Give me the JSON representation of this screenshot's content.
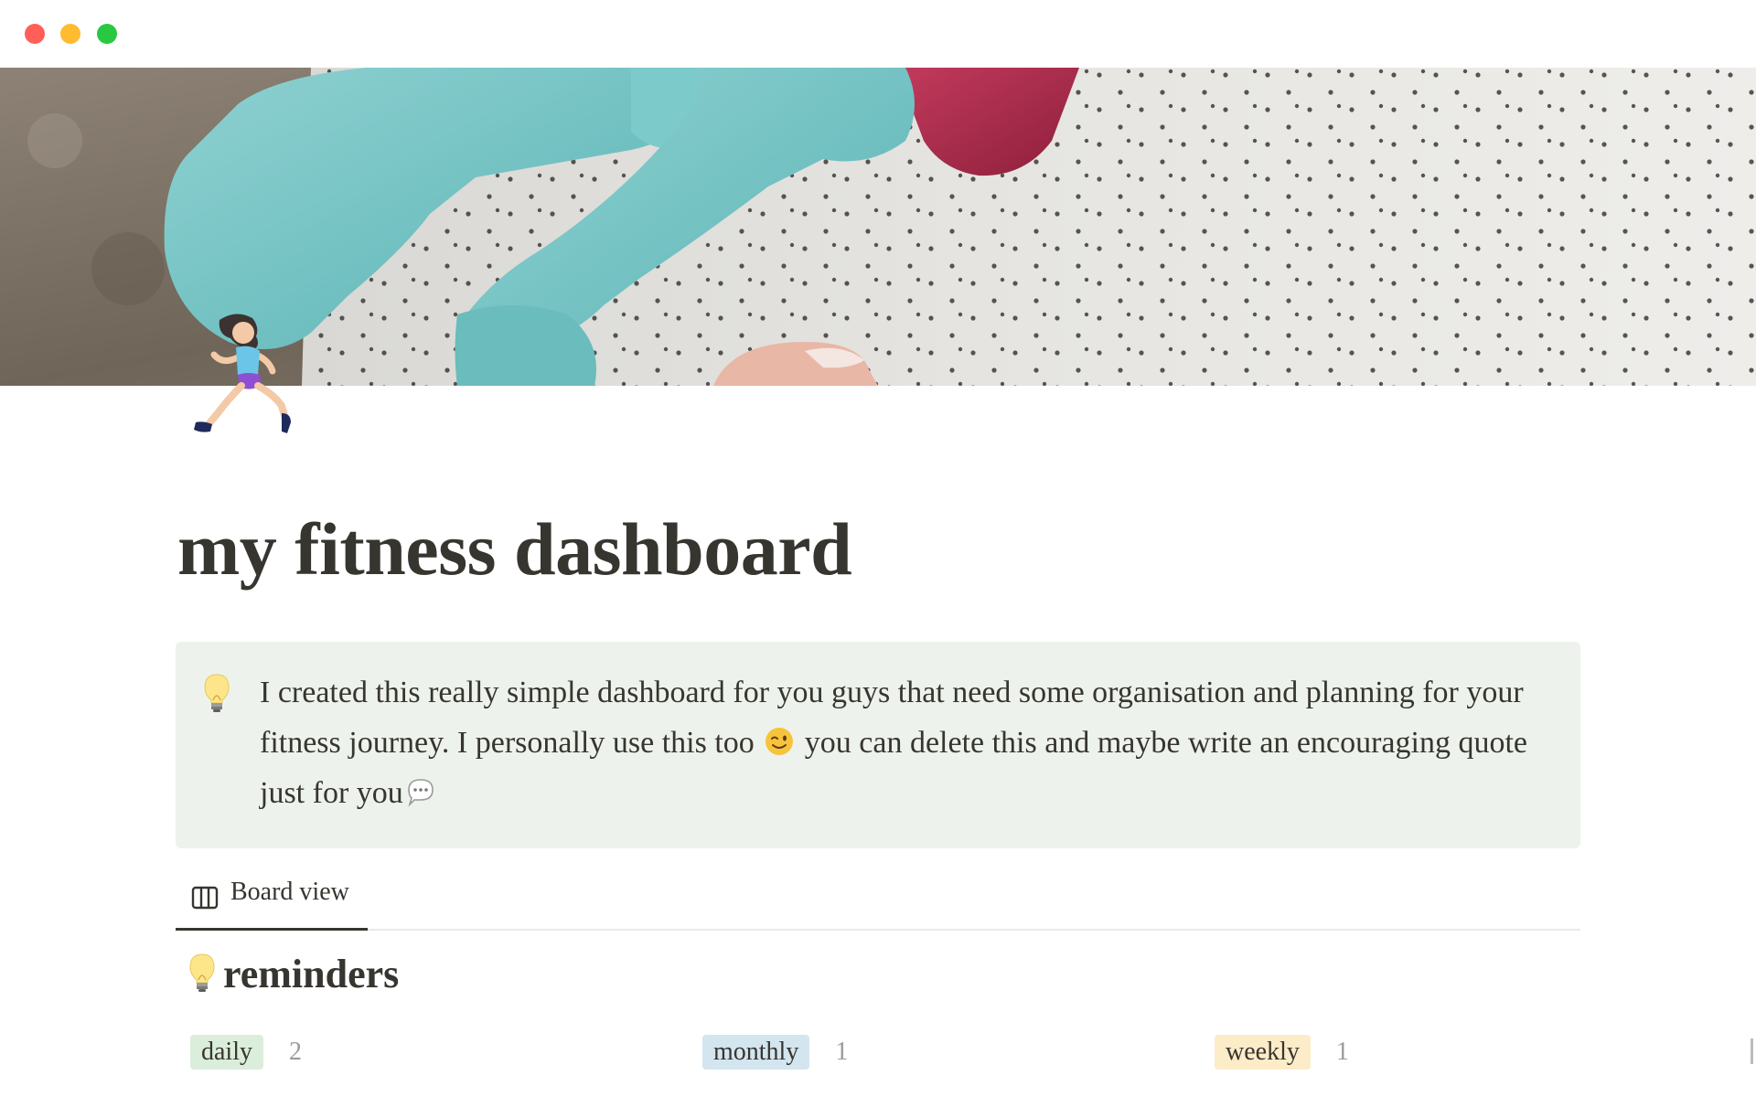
{
  "window": {
    "controls": [
      "close",
      "minimize",
      "maximize"
    ]
  },
  "cover": {
    "icon_name": "dumbbells-cover-image"
  },
  "page": {
    "icon_name": "woman-running-icon",
    "title": "my fitness dashboard"
  },
  "callout": {
    "icon_name": "light-bulb-icon",
    "text_part1": "I created this really simple dashboard for you guys that need some organisation and planning for your fitness journey. I personally use this too",
    "emoji_1": "winking-face-icon",
    "text_part2": "you can delete this and maybe write an encouraging quote just for you",
    "emoji_2": "speech-balloon-icon",
    "background": "#edf3ec"
  },
  "views": {
    "tabs": [
      {
        "label": "Board view",
        "icon_name": "board-icon",
        "active": true
      }
    ]
  },
  "board": {
    "icon_name": "light-bulb-icon",
    "title": "reminders",
    "groups": [
      {
        "label": "daily",
        "count": "2",
        "color": "#dbeddb"
      },
      {
        "label": "monthly",
        "count": "1",
        "color": "#d3e5ef"
      },
      {
        "label": "weekly",
        "count": "1",
        "color": "#fdecc8"
      }
    ]
  }
}
